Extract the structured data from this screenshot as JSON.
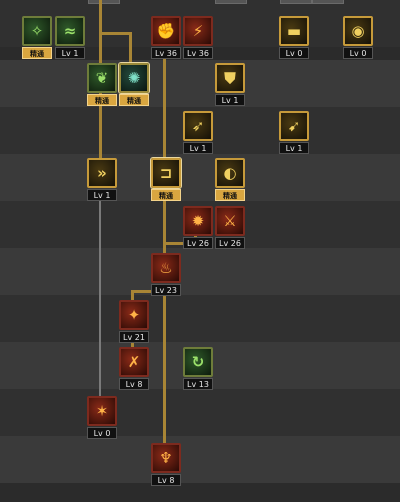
{
  "skills": [
    {
      "id": "s1",
      "col": 0,
      "row": 0,
      "label": "精通",
      "style": "badge",
      "color": "green",
      "icon": "flourish-icon"
    },
    {
      "id": "s2",
      "col": 1,
      "row": 0,
      "label": "Lv 1",
      "style": "lv",
      "color": "green",
      "icon": "scroll-icon"
    },
    {
      "id": "s3",
      "col": 2,
      "row": 0,
      "label": "Lv 36",
      "style": "lv",
      "color": "red",
      "icon": "fist-icon"
    },
    {
      "id": "s4",
      "col": 3,
      "row": 0,
      "label": "Lv 36",
      "style": "lv",
      "color": "red",
      "icon": "kick-icon"
    },
    {
      "id": "s5",
      "col": 4,
      "row": 0,
      "label": "Lv 0",
      "style": "lv",
      "color": "gold",
      "icon": "boot-icon"
    },
    {
      "id": "s6",
      "col": 5,
      "row": 0,
      "label": "Lv 0",
      "style": "lv",
      "color": "gold",
      "icon": "shield-icon"
    },
    {
      "id": "s7",
      "col": 6,
      "row": 1,
      "label": "精通",
      "style": "badge",
      "color": "green",
      "icon": "leaf-icon"
    },
    {
      "id": "s8",
      "col": 7,
      "row": 1,
      "label": "精通",
      "style": "badge",
      "color": "teal",
      "icon": "whirl-icon"
    },
    {
      "id": "s9",
      "col": 8,
      "row": 1,
      "label": "Lv 1",
      "style": "lv",
      "color": "gold",
      "icon": "armor-icon"
    },
    {
      "id": "s10",
      "col": 9,
      "row": 2,
      "label": "Lv 1",
      "style": "lv",
      "color": "gold",
      "icon": "blade-icon"
    },
    {
      "id": "s11",
      "col": 10,
      "row": 2,
      "label": "Lv 1",
      "style": "lv",
      "color": "gold",
      "icon": "sprint-icon"
    },
    {
      "id": "s12",
      "col": 11,
      "row": 3,
      "label": "Lv 1",
      "style": "lv",
      "color": "gold",
      "icon": "dash-icon"
    },
    {
      "id": "s13",
      "col": 12,
      "row": 3,
      "label": "精通",
      "style": "badge",
      "color": "gold",
      "icon": "hook-icon"
    },
    {
      "id": "s14",
      "col": 13,
      "row": 3,
      "label": "精通",
      "style": "badge",
      "color": "gold",
      "icon": "bow-icon"
    },
    {
      "id": "s15",
      "col": 14,
      "row": 4,
      "label": "Lv 26",
      "style": "lv",
      "color": "red",
      "icon": "burst-icon"
    },
    {
      "id": "s16",
      "col": 15,
      "row": 4,
      "label": "Lv 26",
      "style": "lv",
      "color": "red",
      "icon": "kick2-icon"
    },
    {
      "id": "s17",
      "col": 16,
      "row": 5,
      "label": "Lv 23",
      "style": "lv",
      "color": "red",
      "icon": "flame-icon"
    },
    {
      "id": "s18",
      "col": 17,
      "row": 6,
      "label": "Lv 21",
      "style": "lv",
      "color": "red",
      "icon": "strike-icon"
    },
    {
      "id": "s19",
      "col": 18,
      "row": 7,
      "label": "Lv 8",
      "style": "lv",
      "color": "red",
      "icon": "slash-icon"
    },
    {
      "id": "s20",
      "col": 19,
      "row": 7,
      "label": "Lv 13",
      "style": "lv",
      "color": "green",
      "icon": "spin-icon"
    },
    {
      "id": "s21",
      "col": 20,
      "row": 8,
      "label": "Lv 0",
      "style": "lv",
      "color": "red",
      "icon": "sweep-icon"
    },
    {
      "id": "s22",
      "col": 21,
      "row": 9,
      "label": "Lv 8",
      "style": "lv",
      "color": "red",
      "icon": "eruption-icon"
    }
  ]
}
